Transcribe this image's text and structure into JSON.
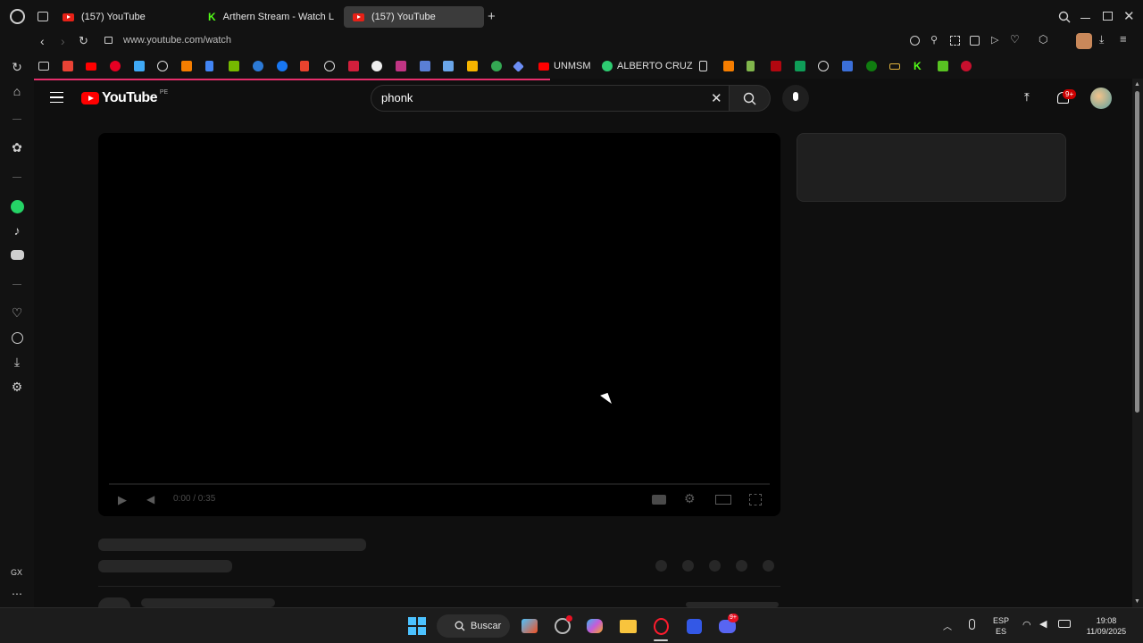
{
  "browser": {
    "tabs": [
      {
        "title": "(157) YouTube",
        "icon": "youtube-favicon",
        "active": false
      },
      {
        "title": "Arthern Stream - Watch L",
        "icon": "kick-favicon",
        "active": false
      },
      {
        "title": "(157) YouTube",
        "icon": "youtube-favicon",
        "active": true
      }
    ],
    "url": "www.youtube.com/watch",
    "bookmarks": {
      "unmsm": "UNMSM",
      "alberto": "ALBERTO CRUZ"
    },
    "sidebar_label": "GX"
  },
  "youtube": {
    "logo_text": "YouTube",
    "country_code": "PE",
    "search_value": "phonk",
    "notification_badge": "9+",
    "player_time": "0:00 / 0:35"
  },
  "taskbar": {
    "search_label": "Buscar",
    "discord_badge": "9+",
    "lang_top": "ESP",
    "lang_bottom": "ES",
    "time": "19:08",
    "date": "11/09/2025"
  },
  "colors": {
    "accent": "#e62e6b",
    "youtube_red": "#ff0000",
    "kick_green": "#53fc18",
    "page_bg": "#0f0f0f"
  }
}
